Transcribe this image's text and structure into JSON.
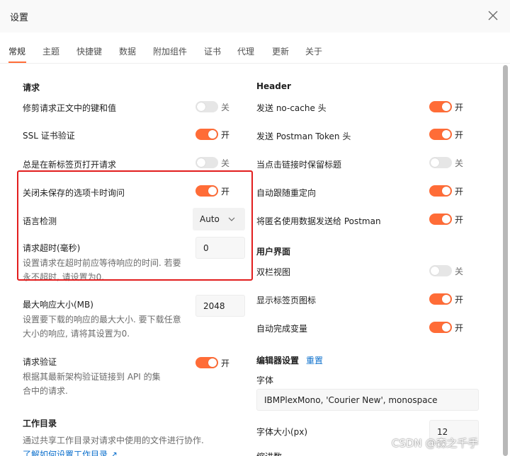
{
  "window": {
    "title": "设置"
  },
  "tabs": [
    "常规",
    "主题",
    "快捷键",
    "数据",
    "附加组件",
    "证书",
    "代理",
    "更新",
    "关于"
  ],
  "state_on": "开",
  "state_off": "关",
  "left": {
    "request_heading": "请求",
    "trim_body": "修剪请求正文中的键和值",
    "ssl_verify": "SSL 证书验证",
    "new_tab": "总是在新标签页打开请求",
    "ask_close": "关闭未保存的选项卡时询问",
    "lang_detect": "语言检测",
    "lang_value": "Auto",
    "timeout_label": "请求超时(毫秒)",
    "timeout_desc": "设置请求在超时前应等待响应的时间. 若要永不超时, 请设置为0.",
    "timeout_value": "0",
    "maxsize_label": "最大响应大小(MB)",
    "maxsize_desc": "设置要下载的响应的最大大小. 要下载任意大小的响应, 请将其设置为0.",
    "maxsize_value": "2048",
    "validation_label": "请求验证",
    "validation_desc": "根据其最新架构验证链接到 API 的集合中的请求.",
    "workdir_heading": "工作目录",
    "workdir_desc": "通过共享工作目录对请求中使用的文件进行协作.",
    "workdir_link": "了解如何设置工作目录 ↗"
  },
  "right": {
    "header_heading": "Header",
    "no_cache": "发送 no-cache 头",
    "postman_token": "发送 Postman Token 头",
    "keep_title": "当点击链接时保留标题",
    "follow_redirect": "自动跟随重定向",
    "anon_data": "将匿名使用数据发送给 Postman",
    "ui_heading": "用户界面",
    "two_pane": "双栏视图",
    "show_tab_icons": "显示标签页图标",
    "autocomplete_vars": "自动完成变量",
    "editor_heading": "编辑器设置",
    "reset_link": "重置",
    "font_label": "字体",
    "font_value": "IBMPlexMono, 'Courier New', monospace",
    "font_size_label": "字体大小(px)",
    "font_size_value": "12",
    "indent_label": "缩进数"
  },
  "toggles": {
    "trim_body": false,
    "ssl_verify": true,
    "new_tab": false,
    "ask_close": true,
    "validation": true,
    "no_cache": true,
    "postman_token": true,
    "keep_title": false,
    "follow_redirect": true,
    "anon_data": true,
    "two_pane": false,
    "show_tab_icons": true,
    "autocomplete_vars": true
  },
  "watermark": "CSDN @森之千手",
  "colors": {
    "accent": "#ff6c37",
    "highlight_border": "#e21d1d",
    "link": "#0b6fcc"
  }
}
